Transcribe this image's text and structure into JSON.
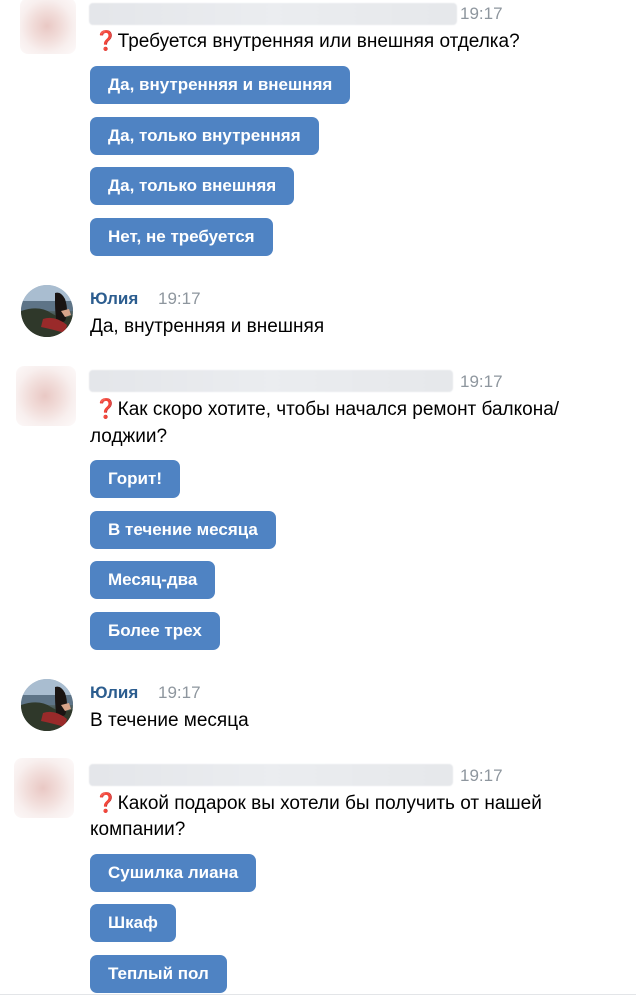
{
  "messages": [
    {
      "type": "bot",
      "time": "19:17",
      "question_icon": "❓",
      "text": "Требуется внутренняя или внешняя отделка?",
      "buttons": [
        "Да, внутренняя и внешняя",
        "Да, только внутренняя",
        "Да, только внешняя",
        "Нет, не требуется"
      ]
    },
    {
      "type": "user",
      "sender": "Юлия",
      "time": "19:17",
      "text": "Да, внутренняя и внешняя"
    },
    {
      "type": "bot",
      "time": "19:17",
      "question_icon": "❓",
      "text_line1": "Как скоро хотите, чтобы начался ремонт балкона/",
      "text_line2": "лоджии?",
      "buttons": [
        "Горит!",
        "В течение месяца",
        "Месяц-два",
        "Более трех"
      ]
    },
    {
      "type": "user",
      "sender": "Юлия",
      "time": "19:17",
      "text": "В течение месяца"
    },
    {
      "type": "bot",
      "time": "19:17",
      "question_icon": "❓",
      "text_line1": "Какой подарок вы хотели бы получить от нашей",
      "text_line2": "компании?",
      "buttons": [
        "Сушилка лиана",
        "Шкаф",
        "Теплый пол"
      ]
    }
  ],
  "colors": {
    "button_bg": "#4f83c3",
    "sender_name": "#2c5d8f",
    "timestamp": "#8e969e",
    "question_icon": "#e0253a"
  },
  "icons": {
    "question": "red-question-mark-icon"
  }
}
